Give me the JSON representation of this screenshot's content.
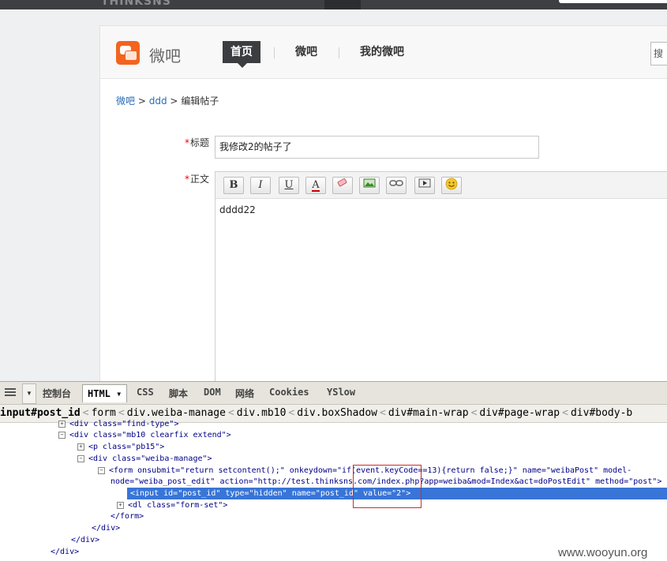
{
  "topbar": {
    "logo": "THINKSNS"
  },
  "header": {
    "app_name": "微吧",
    "nav": [
      "首页",
      "微吧",
      "我的微吧"
    ],
    "search_placeholder": "搜"
  },
  "breadcrumb": {
    "home": "微吧",
    "sep1": ">",
    "group": "ddd",
    "sep2": ">",
    "current": "编辑帖子"
  },
  "form": {
    "required_mark": "*",
    "title_label": "标题",
    "title_value": "我修改2的帖子了",
    "body_label": "正文",
    "body_value": "dddd22",
    "toolbar": [
      "bold",
      "italic",
      "underline",
      "font-color",
      "eraser",
      "image",
      "link",
      "video",
      "emoticon"
    ]
  },
  "firebug": {
    "tabs": [
      "控制台",
      "HTML ▾",
      "CSS",
      "脚本",
      "DOM",
      "网络",
      "Cookies",
      "YSlow"
    ],
    "crumbs": [
      "input#post_id",
      "form",
      "div.weiba-manage",
      "div.mb10",
      "div.boxShadow",
      "div#main-wrap",
      "div#page-wrap",
      "div#body-b"
    ],
    "tree": [
      "<div class=\"find-type\">",
      "<div class=\"mb10 clearfix extend\">",
      "<p class=\"pb15\">",
      "<div class=\"weiba-manage\">",
      "<form onsubmit=\"return setcontent();\" onkeydown=\"if(event.keyCode==13){return false;}\" name=\"weibaPost\" model-",
      "node=\"weiba_post_edit\" action=\"http://test.thinksns.com/index.php?app=weiba&mod=Index&act=doPostEdit\" method=\"post\">",
      "<input id=\"post_id\" type=\"hidden\" name=\"post_id\" value=\"2\">",
      "<dl class=\"form-set\">",
      "</form>",
      "</div>",
      "</div>",
      "</div>"
    ]
  },
  "watermark": "www.wooyun.org"
}
